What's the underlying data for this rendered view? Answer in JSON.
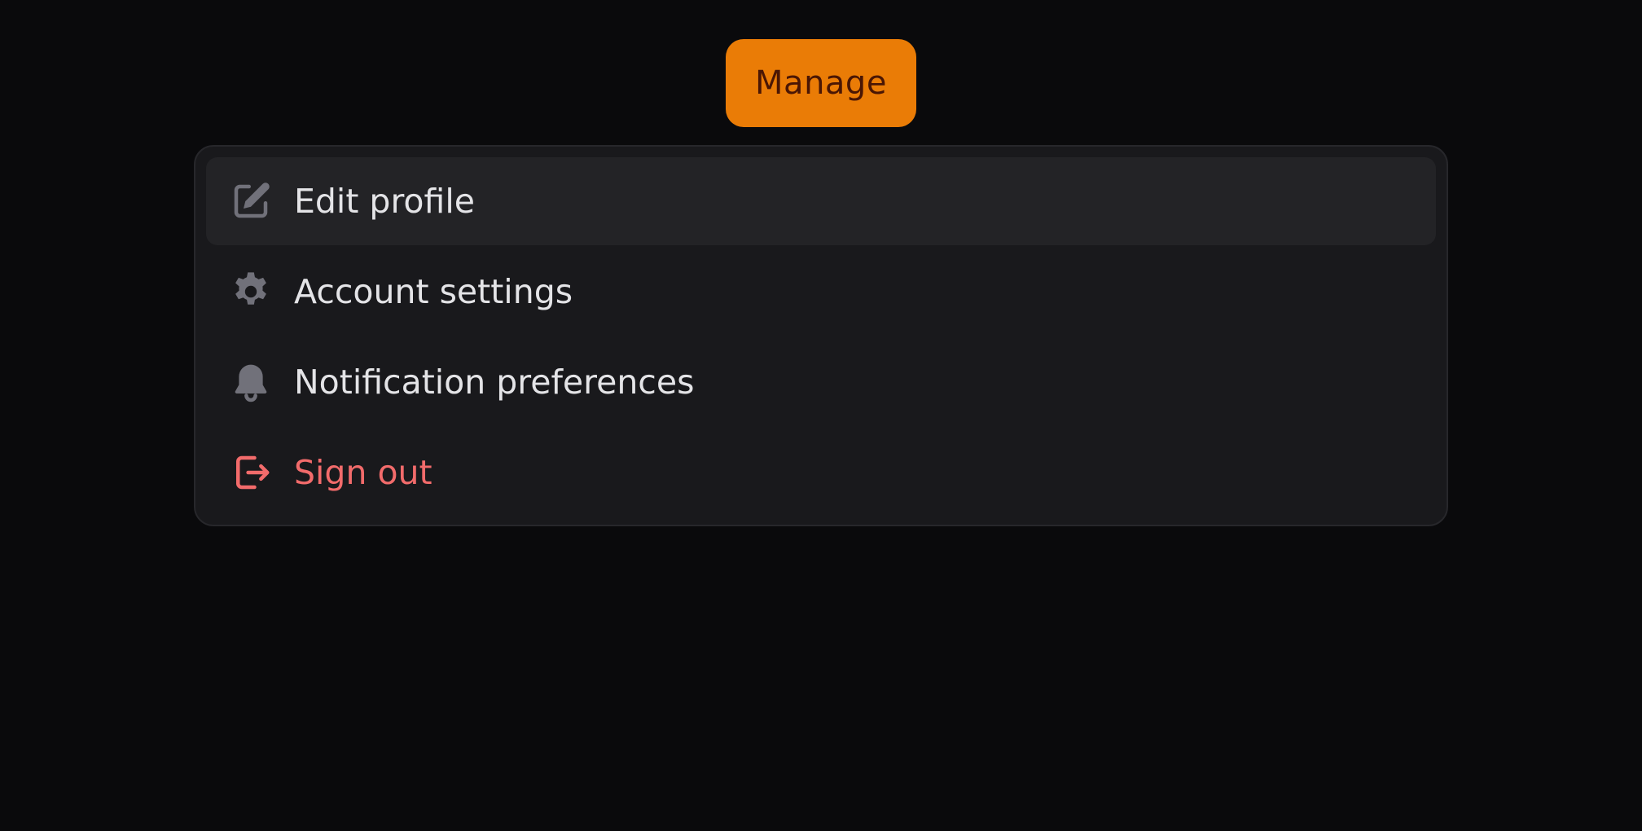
{
  "trigger": {
    "label": "Manage"
  },
  "menu": {
    "items": [
      {
        "label": "Edit profile",
        "icon": "edit-icon",
        "variant": "default",
        "active": true
      },
      {
        "label": "Account settings",
        "icon": "gear-icon",
        "variant": "default",
        "active": false
      },
      {
        "label": "Notification preferences",
        "icon": "bell-icon",
        "variant": "default",
        "active": false
      },
      {
        "label": "Sign out",
        "icon": "sign-out-icon",
        "variant": "danger",
        "active": false
      }
    ]
  },
  "colors": {
    "background": "#0a0a0c",
    "accent": "#ea7c06",
    "accent_text": "#4a1604",
    "menu_bg": "#19191c",
    "menu_active_bg": "#232326",
    "text": "#e4e4e7",
    "icon": "#71717a",
    "danger": "#f26b6b"
  }
}
